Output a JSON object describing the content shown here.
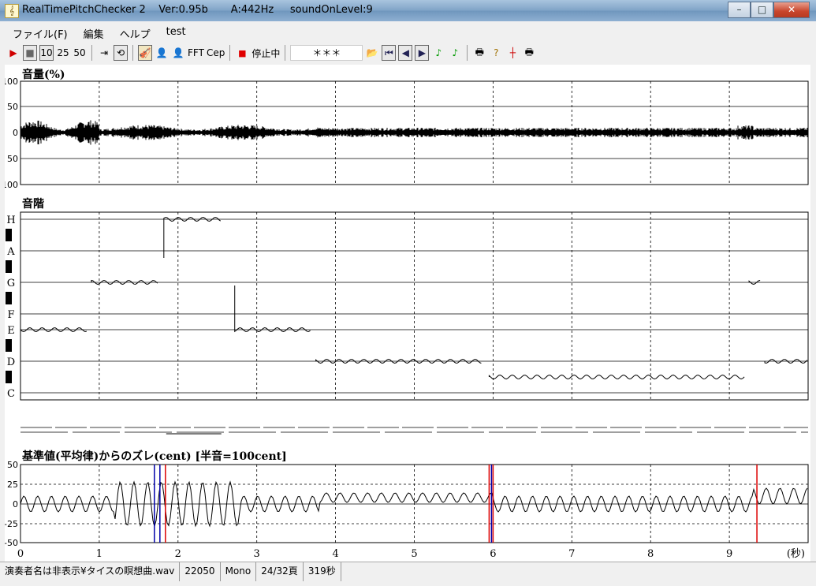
{
  "window": {
    "title": "RealTimePitchChecker 2    Ver:0.95b       A:442Hz     soundOnLevel:9",
    "min_glyph": "–",
    "max_glyph": "□",
    "close_glyph": "✕"
  },
  "menu": [
    "ファイル(F)",
    "編集",
    "ヘルプ",
    "test"
  ],
  "toolbar": {
    "play": "▶",
    "stop": "■",
    "zoom_10": "10",
    "zoom_25": "25",
    "zoom_50": "50",
    "fft": "FFT",
    "cep": "Cep",
    "status_label": "停止中",
    "display": "＊＊＊"
  },
  "volume": {
    "title": "音量(%)",
    "ticks": [
      "100",
      "50",
      "0",
      "50",
      "100"
    ]
  },
  "scale": {
    "title": "音階",
    "notes": [
      "H",
      "A",
      "G",
      "F",
      "E",
      "D",
      "C"
    ]
  },
  "cent": {
    "title": "基準値(平均律)からのズレ(cent) [半音=100cent]",
    "ticks": [
      "50",
      "25",
      "0",
      "-25",
      "-50"
    ]
  },
  "time_axis": {
    "ticks": [
      "0",
      "1",
      "2",
      "3",
      "4",
      "5",
      "6",
      "7",
      "8",
      "9"
    ],
    "unit": "(秒)"
  },
  "statusbar": [
    "演奏者名は非表示¥タイスの瞑想曲.wav",
    "22050",
    "Mono",
    "24/32頁",
    "319秒"
  ],
  "chart_data": {
    "type": "line",
    "note_segments": [
      {
        "t0": 0.0,
        "t1": 0.85,
        "note": "E"
      },
      {
        "t0": 0.9,
        "t1": 1.75,
        "note": "G"
      },
      {
        "t0": 1.82,
        "t1": 2.55,
        "note": "H"
      },
      {
        "t0": 2.72,
        "t1": 3.7,
        "note": "E"
      },
      {
        "t0": 3.75,
        "t1": 5.85,
        "note": "D"
      },
      {
        "t0": 5.95,
        "t1": 9.2,
        "note": "C#"
      },
      {
        "t0": 9.25,
        "t1": 9.4,
        "note": "G"
      },
      {
        "t0": 9.45,
        "t1": 10.0,
        "note": "D"
      }
    ],
    "cent_ylim": [
      -50,
      50
    ],
    "volume_ylim": [
      -100,
      100
    ],
    "xlim": [
      0,
      10
    ]
  }
}
